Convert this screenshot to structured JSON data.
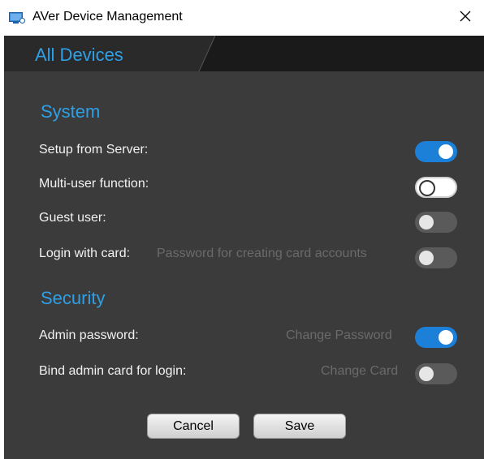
{
  "window": {
    "title": "AVer Device Management"
  },
  "tabs": [
    {
      "label": "All Devices"
    }
  ],
  "system": {
    "heading": "System",
    "rows": [
      {
        "label": "Setup from Server:",
        "state": "on"
      },
      {
        "label": "Multi-user function:",
        "state": "off"
      },
      {
        "label": "Guest user:",
        "state": "off",
        "disabled": true
      },
      {
        "label": "Login with card:",
        "hint": "Password for creating card accounts",
        "state": "off",
        "disabled": true
      }
    ]
  },
  "security": {
    "heading": "Security",
    "rows": [
      {
        "label": "Admin password:",
        "hint": "Change Password",
        "state": "on"
      },
      {
        "label": "Bind admin card for login:",
        "hint": "Change Card",
        "state": "off",
        "disabled": true
      }
    ]
  },
  "footer": {
    "cancel_label": "Cancel",
    "save_label": "Save"
  },
  "colors": {
    "accent": "#2ea0e8",
    "toggle_on": "#1c7fd8",
    "panel": "#3b3b3b",
    "tabbar": "#1a1a1a"
  },
  "icons": {
    "app": "monitor-app-icon",
    "close": "close-icon"
  }
}
